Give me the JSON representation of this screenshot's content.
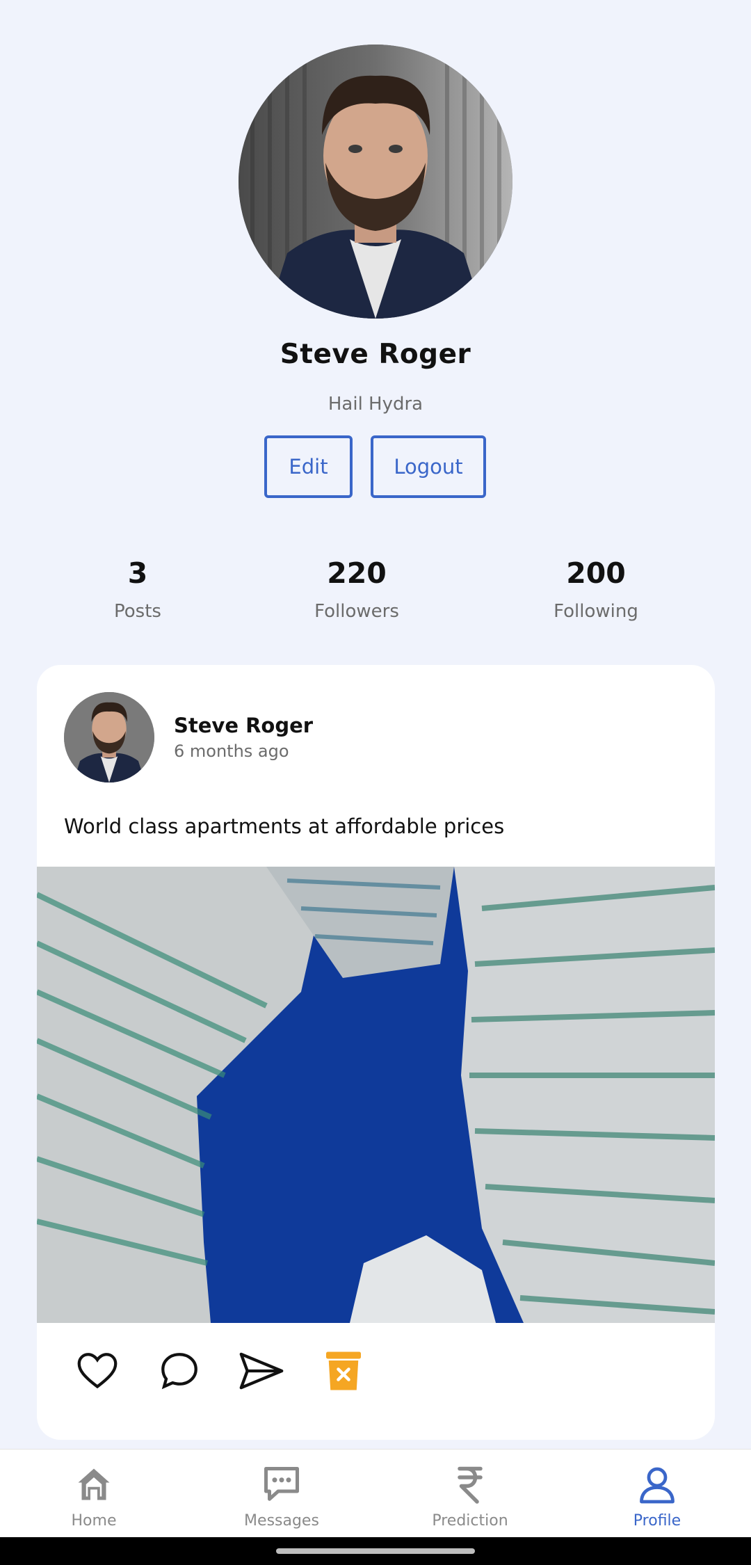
{
  "profile": {
    "name": "Steve Roger",
    "bio": "Hail Hydra",
    "edit_label": "Edit",
    "logout_label": "Logout"
  },
  "stats": {
    "posts": {
      "value": "3",
      "label": "Posts"
    },
    "followers": {
      "value": "220",
      "label": "Followers"
    },
    "following": {
      "value": "200",
      "label": "Following"
    }
  },
  "post": {
    "author": "Steve Roger",
    "time": "6 months ago",
    "text": "World class apartments at affordable prices",
    "actions": [
      "heart-icon",
      "comment-icon",
      "send-icon",
      "delete-icon"
    ]
  },
  "nav": {
    "home": "Home",
    "messages": "Messages",
    "prediction": "Prediction",
    "profile": "Profile",
    "active": "Profile"
  },
  "colors": {
    "accent": "#3a66c9",
    "background": "#f0f3fc",
    "delete": "#f5a623"
  }
}
